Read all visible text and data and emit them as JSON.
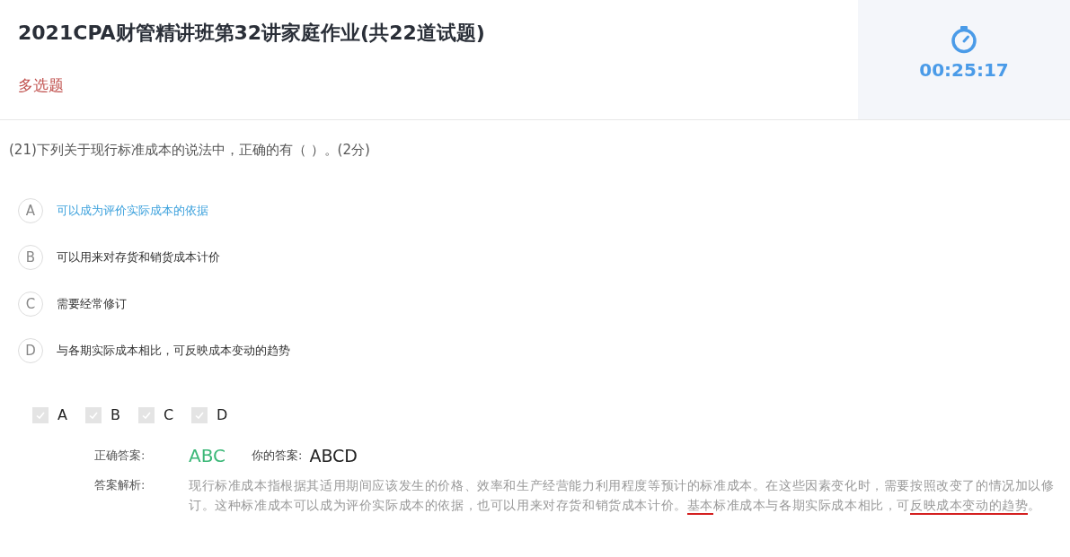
{
  "header": {
    "title": "2021CPA财管精讲班第32讲家庭作业(共22道试题)",
    "question_type": "多选题",
    "timer": "00:25:17"
  },
  "question": {
    "text": "(21)下列关于现行标准成本的说法中，正确的有（    ）。(2分)"
  },
  "options": [
    {
      "letter": "A",
      "text": "可以成为评价实际成本的依据",
      "highlighted": true
    },
    {
      "letter": "B",
      "text": "可以用来对存货和销货成本计价",
      "highlighted": false
    },
    {
      "letter": "C",
      "text": "需要经常修订",
      "highlighted": false
    },
    {
      "letter": "D",
      "text": "与各期实际成本相比，可反映成本变动的趋势",
      "highlighted": false
    }
  ],
  "choices": [
    {
      "label": "A",
      "checked": true,
      "disabled": true
    },
    {
      "label": "B",
      "checked": true,
      "disabled": true
    },
    {
      "label": "C",
      "checked": true,
      "disabled": true
    },
    {
      "label": "D",
      "checked": true,
      "disabled": true
    }
  ],
  "answer": {
    "correct_label": "正确答案:",
    "correct": "ABC",
    "yours_label": "你的答案:",
    "yours": "ABCD",
    "explanation_label": "答案解析:",
    "explanation": [
      {
        "text": "现行标准成本指根据其适用期间应该发生的价格、效率和生产经营能力利用程度等预计的标准成本。在这些因素变化时，需要按照改变了的情况加以修订。这种标准成本可以成为评价实际成本的依据，也可以用来对存货和销货成本计价。",
        "underlined": false
      },
      {
        "text": "基本",
        "underlined": true
      },
      {
        "text": "标准成本与各期实际成本相比，可",
        "underlined": false
      },
      {
        "text": "反映成本变动的趋势",
        "underlined": true
      },
      {
        "text": "。",
        "underlined": false
      }
    ]
  }
}
